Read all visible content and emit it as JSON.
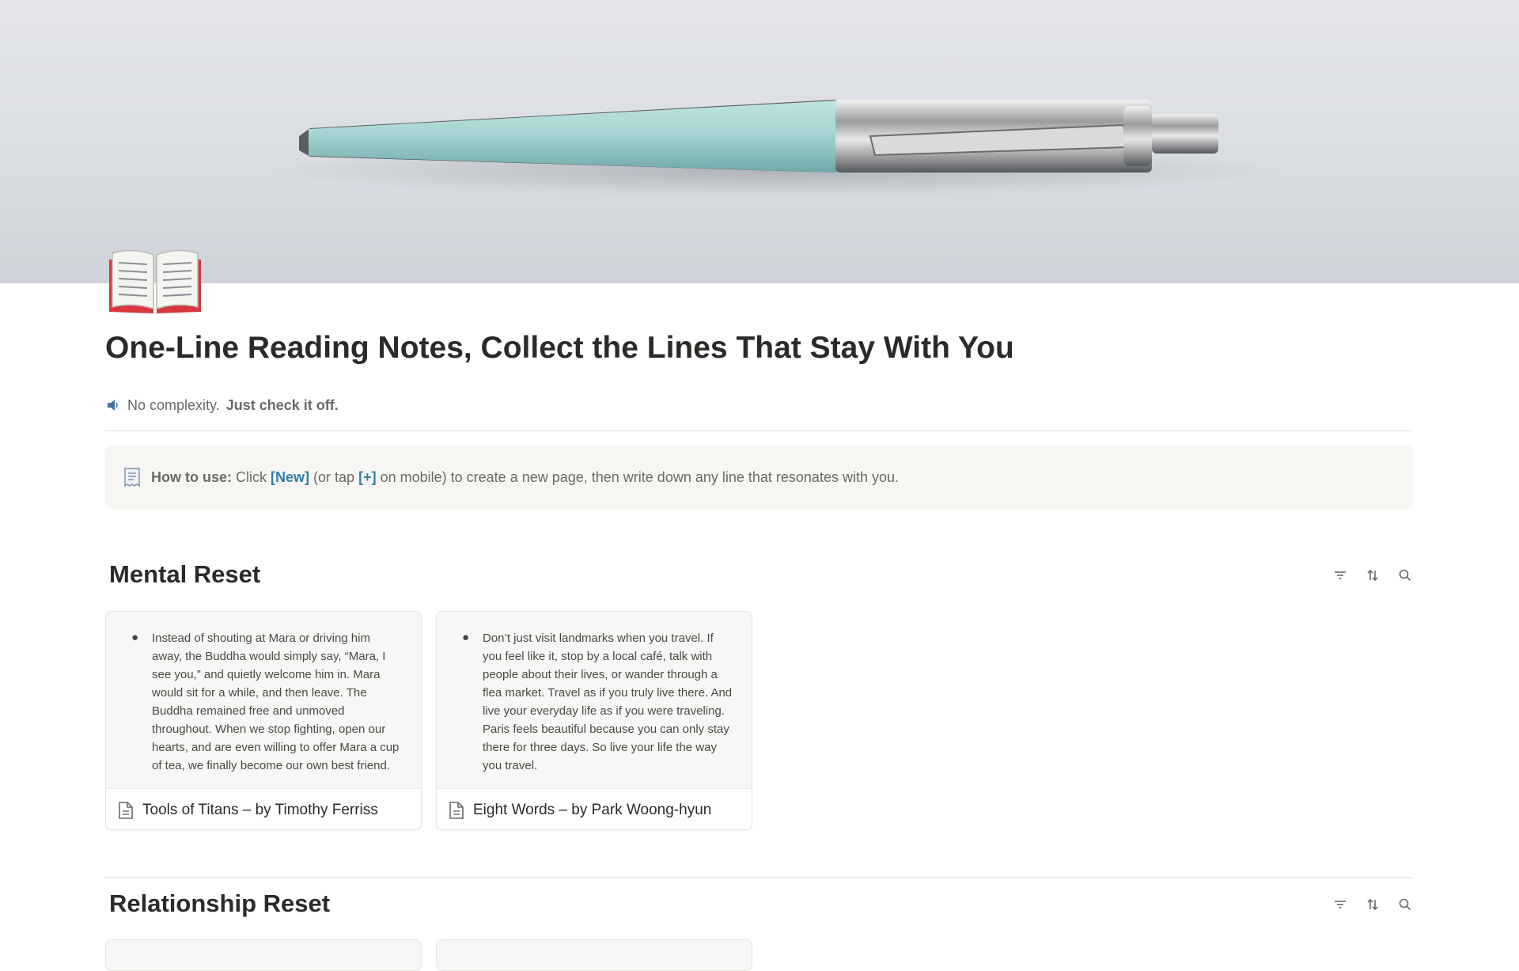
{
  "page": {
    "title": "One-Line Reading Notes, Collect the Lines That Stay With You",
    "subtitle_plain": "No complexity.",
    "subtitle_bold": "Just check it off."
  },
  "callout": {
    "label": "How to use:",
    "text_1": "Click",
    "new_label": "[New]",
    "text_2": "(or tap",
    "plus_label": "[+]",
    "text_3": "on mobile) to create a new page, then write down any line that resonates with you."
  },
  "sections": [
    {
      "title": "Mental Reset",
      "cards": [
        {
          "quote": "Instead of shouting at Mara or driving him away, the Buddha would simply say, “Mara, I see you,” and quietly welcome him in. Mara would sit for a while, and then leave. The Buddha remained free and unmoved throughout. When we stop fighting, open our hearts, and are even willing to offer Mara a cup of tea, we finally become our own best friend.",
          "title": "Tools of Titans – by Timothy Ferriss"
        },
        {
          "quote": "Don’t just visit landmarks when you travel. If you feel like it, stop by a local café, talk with people about their lives, or wander through a flea market. Travel as if you truly live there. And live your everyday life as if you were traveling. Paris feels beautiful because you can only stay there for three days. So live your life the way you travel.",
          "title": "Eight Words – by Park Woong-hyun"
        }
      ]
    },
    {
      "title": "Relationship Reset",
      "cards": []
    }
  ],
  "icons": {
    "page": "open-book-icon",
    "subtitle": "speaker-icon",
    "callout": "receipt-icon",
    "filter": "filter-icon",
    "sort": "sort-icon",
    "search": "search-icon",
    "card": "document-icon"
  },
  "colors": {
    "link": "#337ea9",
    "callout_bg": "#f7f6f3",
    "text": "#37352f"
  }
}
